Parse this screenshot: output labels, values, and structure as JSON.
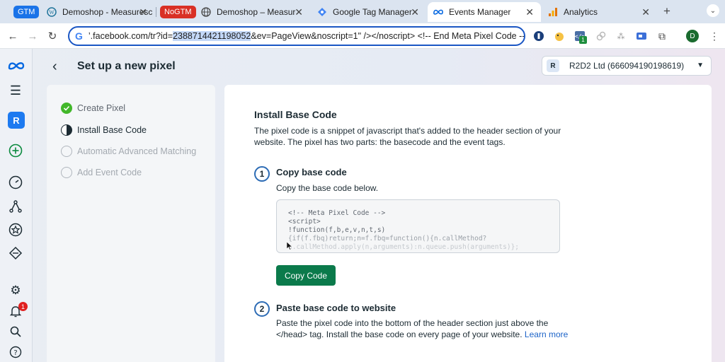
{
  "browser": {
    "tabs": [
      {
        "group": "GTM",
        "title": "Demoshop - Measuresc",
        "favicon": "wordpress-icon"
      },
      {
        "group": "NoGTM",
        "title": "Demoshop – MeasureSc",
        "favicon": "globe-icon"
      },
      {
        "title": "Google Tag Manager",
        "favicon": "tag-manager-icon"
      },
      {
        "title": "Events Manager",
        "favicon": "meta-icon",
        "active": true
      },
      {
        "title": "Analytics",
        "favicon": "analytics-icon"
      }
    ],
    "new_tab": "+",
    "url_prefix": "facebook.com/tr?id=",
    "url_highlight": "2388714421198052",
    "url_suffix": "&ev=PageView&noscript=1\" /></noscript> <!-- End Meta Pixel Code -->",
    "url_leading": "’.",
    "extension_badge": "1",
    "profile_initial": "D"
  },
  "nav": {
    "account_initial": "R",
    "notification_count": "1"
  },
  "header": {
    "title": "Set up a new pixel",
    "account_selector": "R2D2 Ltd (666094190198619)",
    "account_badge": "R"
  },
  "steps": [
    {
      "label": "Create Pixel",
      "state": "done"
    },
    {
      "label": "Install Base Code",
      "state": "current"
    },
    {
      "label": "Automatic Advanced Matching",
      "state": "pending"
    },
    {
      "label": "Add Event Code",
      "state": "pending"
    }
  ],
  "main": {
    "heading": "Install Base Code",
    "description": "The pixel code is a snippet of javascript that's added to the header section of your website. The pixel has two parts: the basecode and the event tags.",
    "step1": {
      "number": "1",
      "title": "Copy base code",
      "text": "Copy the base code below.",
      "code": [
        "<!-- Meta Pixel Code -->",
        "<script>",
        "!function(f,b,e,v,n,t,s)",
        "{if(f.fbq)return;n=f.fbq=function(){n.callMethod?",
        "n.callMethod.apply(n,arguments):n.queue.push(arguments)};"
      ],
      "button": "Copy Code"
    },
    "step2": {
      "number": "2",
      "title": "Paste base code to website",
      "text": "Paste the pixel code into the bottom of the header section just above the </head> tag. Install the base code on every page of your website.",
      "link": "Learn more"
    }
  },
  "colors": {
    "accent": "#1d7af0",
    "primary_button": "#0b7a4b",
    "step_done": "#42b72a",
    "gtm_chip": "#1a73e8",
    "nogtm_chip": "#d93025"
  }
}
